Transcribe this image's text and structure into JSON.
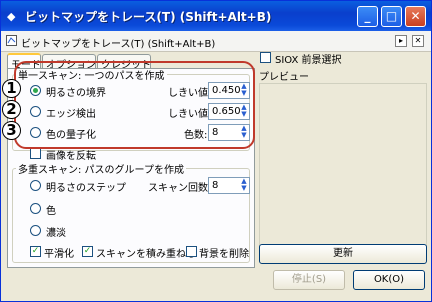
{
  "window": {
    "title": "ビットマップをトレース(T) (Shift+Alt+B)",
    "min": "_",
    "max": "□",
    "close": "✕"
  },
  "subheader": {
    "title": "ビットマップをトレース(T) (Shift+Alt+B)"
  },
  "tabs": [
    "モード",
    "オプション",
    "クレジット"
  ],
  "single_scan": {
    "legend": "単一スキャン: 一つのパスを作成",
    "rows": [
      {
        "label": "明るさの境界",
        "param": "しきい値:",
        "value": "0.450"
      },
      {
        "label": "エッジ検出",
        "param": "しきい値:",
        "value": "0.650"
      },
      {
        "label": "色の量子化",
        "param": "色数:",
        "value": "8"
      }
    ],
    "markers": [
      "1",
      "2",
      "3"
    ],
    "invert": "画像を反転"
  },
  "multi_scan": {
    "legend": "多重スキャン: パスのグループを作成",
    "rows": [
      {
        "label": "明るさのステップ",
        "param": "スキャン回数:",
        "value": "8"
      },
      {
        "label": "色"
      },
      {
        "label": "濃淡"
      }
    ],
    "smooth": "平滑化",
    "stack": "スキャンを積み重ねる",
    "remove_bg": "背景を削除"
  },
  "siox": "SIOX 前景選択",
  "preview": {
    "label": "プレビュー",
    "update": "更新"
  },
  "buttons": {
    "stop": "停止(S)",
    "ok": "OK(O)"
  }
}
